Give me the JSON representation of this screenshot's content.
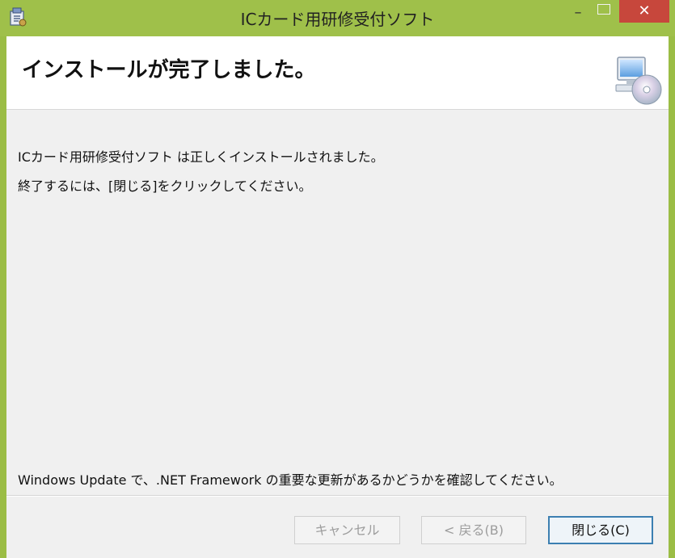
{
  "window": {
    "title": "ICカード用研修受付ソフト",
    "controls": {
      "minimize": "–",
      "close": "✕"
    }
  },
  "header": {
    "title": "インストールが完了しました。",
    "icon": "setup-computer-disc-icon"
  },
  "body": {
    "line1": "ICカード用研修受付ソフト は正しくインストールされました。",
    "line2": "終了するには、[閉じる]をクリックしてください。",
    "line3": "Windows Update で、.NET Framework の重要な更新があるかどうかを確認してください。"
  },
  "buttons": {
    "cancel": "キャンセル",
    "back": "< 戻る(B)",
    "close": "閉じる(C)"
  },
  "colors": {
    "titlebar": "#9fc04a",
    "close_button": "#c7473c",
    "dialog_background": "#f0f0f0",
    "primary_border": "#3c7fb1"
  }
}
